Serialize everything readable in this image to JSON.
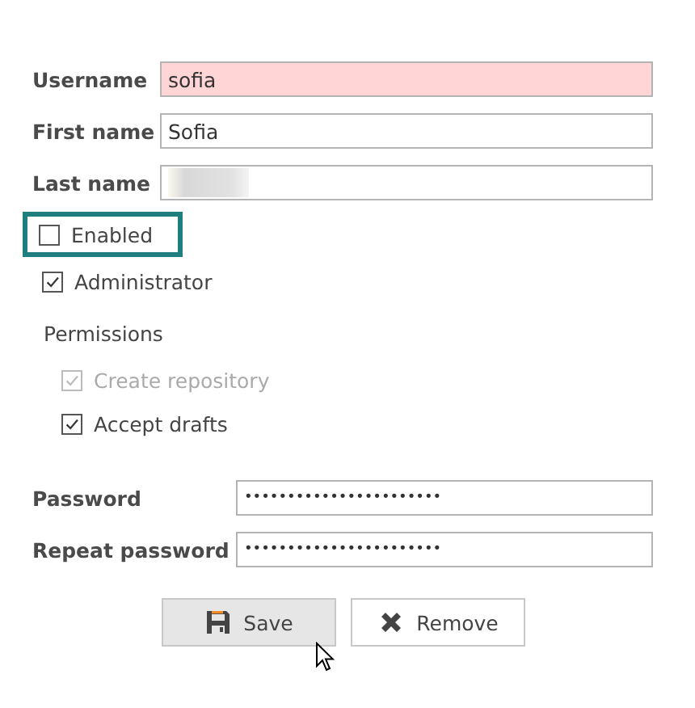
{
  "fields": [
    {
      "label": "Username",
      "value": "sofia",
      "invalid": true,
      "redacted": false
    },
    {
      "label": "First name",
      "value": "Sofia",
      "invalid": false,
      "redacted": false
    },
    {
      "label": "Last name",
      "invalid": false,
      "redacted": true
    }
  ],
  "checkboxes": [
    {
      "label": "Enabled",
      "checked": false,
      "focused": true,
      "disabled": false
    },
    {
      "label": "Administrator",
      "checked": true,
      "focused": false,
      "disabled": false
    }
  ],
  "permissions": {
    "title": "Permissions",
    "items": [
      {
        "label": "Create repository",
        "checked": true,
        "disabled": true
      },
      {
        "label": "Accept drafts",
        "checked": true,
        "disabled": false
      }
    ]
  },
  "passwords": [
    {
      "label": "Password",
      "value": "•••••••••••••••••••••••"
    },
    {
      "label": "Repeat password",
      "value": "•••••••••••••••••••••••"
    }
  ],
  "buttons": [
    {
      "label": "Save",
      "kind": "save",
      "hovered": true
    },
    {
      "label": "Remove",
      "kind": "remove",
      "hovered": false
    }
  ]
}
